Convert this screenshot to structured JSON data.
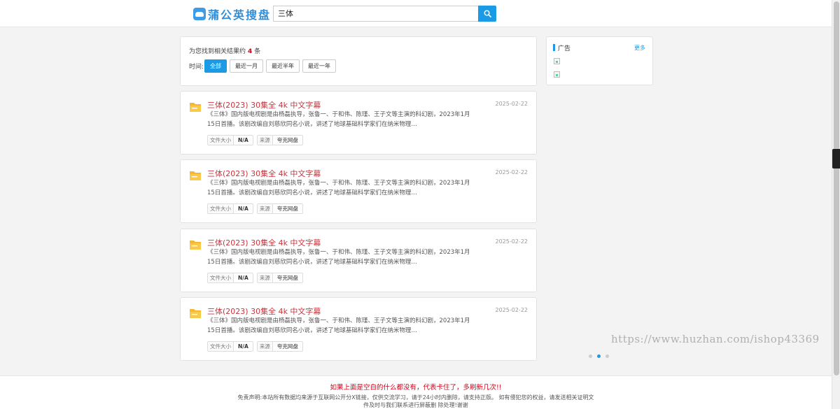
{
  "header": {
    "logo_text": "蒲公英搜盘",
    "search_value": "三体"
  },
  "summary": {
    "prefix": "为您找到相关结果约",
    "count": "4",
    "suffix": "条"
  },
  "filters": {
    "label": "时间:",
    "options": [
      "全部",
      "最近一月",
      "最近半年",
      "最近一年"
    ],
    "selected": "全部"
  },
  "results": [
    {
      "title": "三体(2023) 30集全 4k 中文字幕",
      "date": "2025-02-22",
      "desc": "《三体》国内版电视剧是由杨磊执导，张鲁一、于和伟、陈瑾、王子文等主演的科幻剧，2023年1月15日首播。该剧改编自刘慈欣同名小说，讲述了地球基础科学家们在纳米物理…",
      "size_label": "文件大小",
      "size_value": "N/A",
      "source_label": "来源",
      "source_value": "夸克网盘"
    },
    {
      "title": "三体(2023) 30集全 4k 中文字幕",
      "date": "2025-02-22",
      "desc": "《三体》国内版电视剧是由杨磊执导，张鲁一、于和伟、陈瑾、王子文等主演的科幻剧，2023年1月15日首播。该剧改编自刘慈欣同名小说，讲述了地球基础科学家们在纳米物理…",
      "size_label": "文件大小",
      "size_value": "N/A",
      "source_label": "来源",
      "source_value": "夸克网盘"
    },
    {
      "title": "三体(2023) 30集全 4k 中文字幕",
      "date": "2025-02-22",
      "desc": "《三体》国内版电视剧是由杨磊执导，张鲁一、于和伟、陈瑾、王子文等主演的科幻剧，2023年1月15日首播。该剧改编自刘慈欣同名小说，讲述了地球基础科学家们在纳米物理…",
      "size_label": "文件大小",
      "size_value": "N/A",
      "source_label": "来源",
      "source_value": "夸克网盘"
    },
    {
      "title": "三体(2023) 30集全 4k 中文字幕",
      "date": "2025-02-22",
      "desc": "《三体》国内版电视剧是由杨磊执导，张鲁一、于和伟、陈瑾、王子文等主演的科幻剧，2023年1月15日首播。该剧改编自刘慈欣同名小说，讲述了地球基础科学家们在纳米物理…",
      "size_label": "文件大小",
      "size_value": "N/A",
      "source_label": "来源",
      "source_value": "夸克网盘"
    }
  ],
  "ad": {
    "title": "广告",
    "more": "更多"
  },
  "carousel": {
    "count": 3,
    "active_index": 1
  },
  "watermark": "https://www.huzhan.com/ishop43369",
  "footer": {
    "warning": "如果上面是空白的什么都没有，代表卡住了，多刷新几次!!",
    "disclaimer": "免责声明:本站所有数据均来源于互联网公开分X链接，仅供交流学习，请于24小时内删除，请支持正版。 如有侵犯您的权益，请发送相关证明文件及时与我们联系进行屏蔽删 除处理!谢谢"
  },
  "colors": {
    "accent": "#1b9ae6",
    "title_red": "#c7353e",
    "warn_red": "#d0021b",
    "folder_yellow": "#f5b82e"
  }
}
